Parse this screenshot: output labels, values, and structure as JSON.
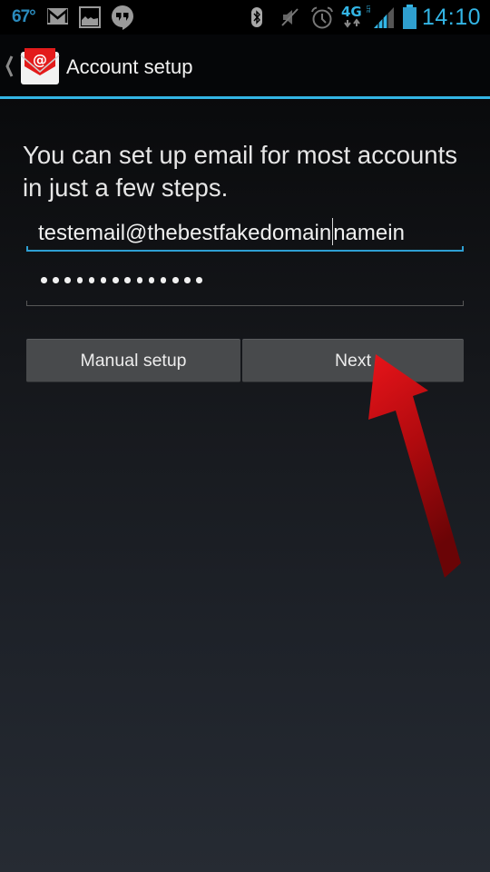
{
  "status_bar": {
    "temperature": "67°",
    "notification_icons": [
      "gmail-icon",
      "gallery-icon",
      "hangouts-icon"
    ],
    "system_icons": [
      "bluetooth-icon",
      "mute-icon",
      "alarm-icon",
      "4g-lte-icon",
      "signal-icon",
      "battery-icon"
    ],
    "network": "4G",
    "network_sub": "LTE",
    "time": "14:10",
    "accent_color": "#33b5e5"
  },
  "action_bar": {
    "back_icon": "chevron-left-icon",
    "app_icon": "email-app-icon",
    "title": "Account setup"
  },
  "form": {
    "intro_text": "You can set up email for most accounts in just a few steps.",
    "email": {
      "value_before_caret": "testemail@thebestfakedomain",
      "value_after_caret": "namein",
      "focused": true
    },
    "password": {
      "masked_length": 14
    }
  },
  "buttons": {
    "manual_setup": "Manual setup",
    "next": "Next"
  },
  "annotation": {
    "type": "arrow",
    "color": "#cc0000",
    "points_to": "next-button"
  }
}
